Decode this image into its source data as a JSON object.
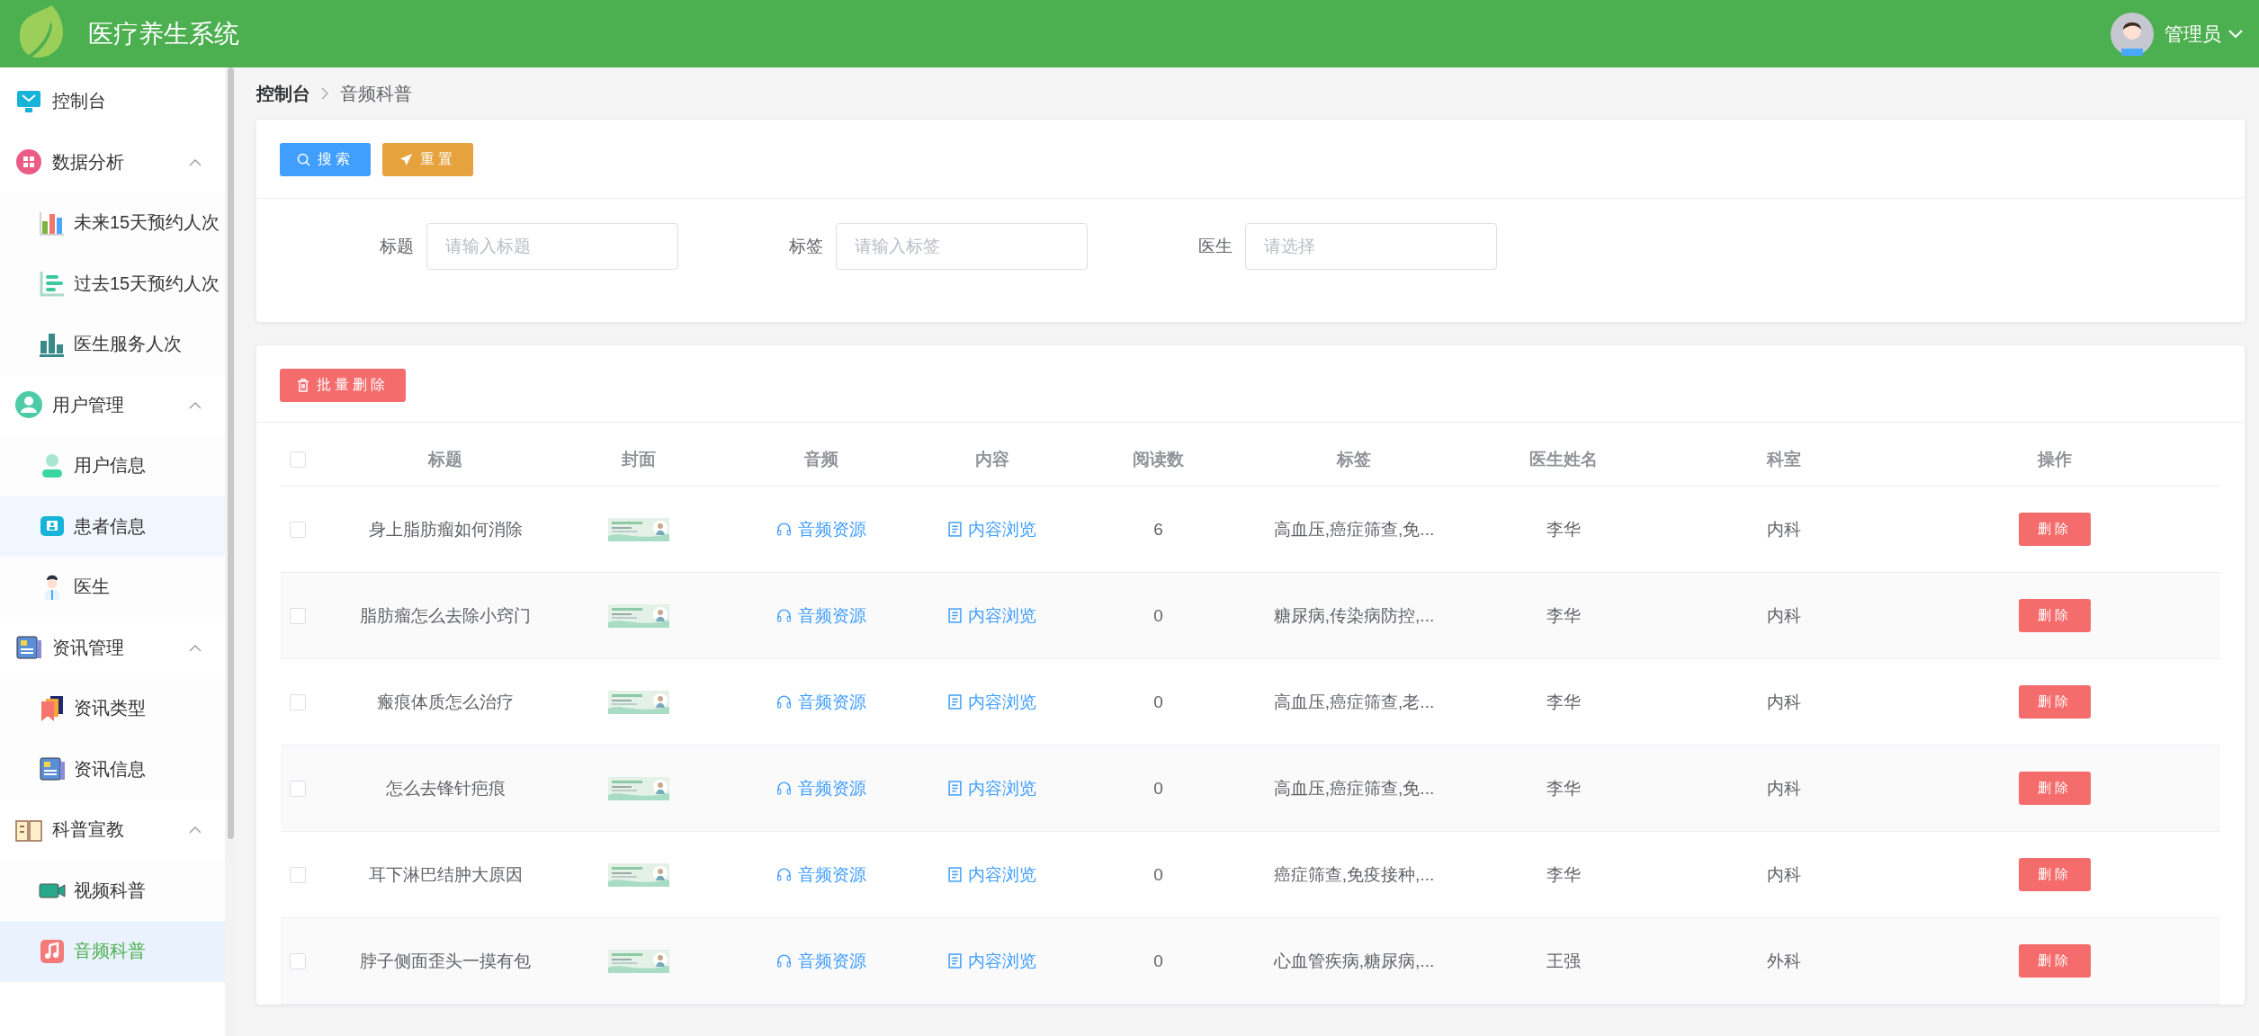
{
  "header": {
    "title": "医疗养生系统",
    "user": {
      "name": "管理员"
    }
  },
  "sidebar": {
    "items": [
      {
        "label": "控制台",
        "selected": false,
        "hovered": false
      },
      {
        "label": "数据分析",
        "expanded": true,
        "children": [
          {
            "label": "未来15天预约人次",
            "selected": false,
            "hovered": false
          },
          {
            "label": "过去15天预约人次",
            "selected": false,
            "hovered": false
          },
          {
            "label": "医生服务人次",
            "selected": false,
            "hovered": false
          }
        ]
      },
      {
        "label": "用户管理",
        "expanded": true,
        "children": [
          {
            "label": "用户信息",
            "selected": false,
            "hovered": false
          },
          {
            "label": "患者信息",
            "selected": false,
            "hovered": true
          },
          {
            "label": "医生",
            "selected": false,
            "hovered": false
          }
        ]
      },
      {
        "label": "资讯管理",
        "expanded": true,
        "children": [
          {
            "label": "资讯类型",
            "selected": false,
            "hovered": false
          },
          {
            "label": "资讯信息",
            "selected": false,
            "hovered": false
          }
        ]
      },
      {
        "label": "科普宣教",
        "expanded": true,
        "children": [
          {
            "label": "视频科普",
            "selected": false,
            "hovered": false
          },
          {
            "label": "音频科普",
            "selected": true,
            "hovered": false
          }
        ]
      }
    ]
  },
  "breadcrumb": [
    "控制台",
    "音频科普"
  ],
  "search_panel": {
    "buttons": [
      {
        "kind": "search",
        "label": "搜索"
      },
      {
        "kind": "reset",
        "label": "重置"
      }
    ],
    "fields": [
      {
        "label": "标题",
        "placeholder": "请输入标题"
      },
      {
        "label": "标签",
        "placeholder": "请输入标签"
      },
      {
        "label": "医生",
        "placeholder": "请选择"
      }
    ]
  },
  "table": {
    "batch_delete": "批量删除",
    "select_all": {
      "checked": false
    },
    "columns": [
      "标题",
      "封面",
      "音频",
      "内容",
      "阅读数",
      "标签",
      "医生姓名",
      "科室",
      "操作"
    ],
    "rows": [
      {
        "checked": false,
        "title": "身上脂肪瘤如何消除",
        "audio": "音频资源",
        "content": "内容浏览",
        "reads": "6",
        "tags": "高血压,癌症筛查,免...",
        "doctor": "李华",
        "department": "内科",
        "action": "删除"
      },
      {
        "checked": false,
        "title": "脂肪瘤怎么去除小窍门",
        "audio": "音频资源",
        "content": "内容浏览",
        "reads": "0",
        "tags": "糖尿病,传染病防控,...",
        "doctor": "李华",
        "department": "内科",
        "action": "删除"
      },
      {
        "checked": false,
        "title": "瘢痕体质怎么治疗",
        "audio": "音频资源",
        "content": "内容浏览",
        "reads": "0",
        "tags": "高血压,癌症筛查,老...",
        "doctor": "李华",
        "department": "内科",
        "action": "删除"
      },
      {
        "checked": false,
        "title": "怎么去锋针疤痕",
        "audio": "音频资源",
        "content": "内容浏览",
        "reads": "0",
        "tags": "高血压,癌症筛查,免...",
        "doctor": "李华",
        "department": "内科",
        "action": "删除"
      },
      {
        "checked": false,
        "title": "耳下淋巴结肿大原因",
        "audio": "音频资源",
        "content": "内容浏览",
        "reads": "0",
        "tags": "癌症筛查,免疫接种,...",
        "doctor": "李华",
        "department": "内科",
        "action": "删除"
      },
      {
        "checked": false,
        "title": "脖子侧面歪头一摸有包",
        "audio": "音频资源",
        "content": "内容浏览",
        "reads": "0",
        "tags": "心血管疾病,糖尿病,...",
        "doctor": "王强",
        "department": "外科",
        "action": "删除"
      }
    ]
  }
}
